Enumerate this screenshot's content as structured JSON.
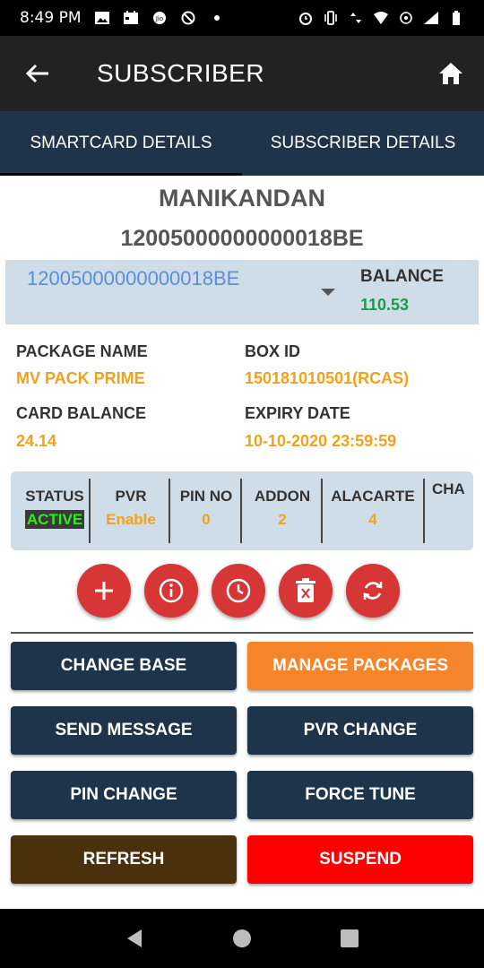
{
  "status_bar": {
    "time": "8:49 PM"
  },
  "app_bar": {
    "title": "SUBSCRIBER"
  },
  "tabs": [
    {
      "label": "SMARTCARD DETAILS",
      "active": true
    },
    {
      "label": "SUBSCRIBER DETAILS",
      "active": false
    }
  ],
  "subscriber": {
    "name": "MANIKANDAN",
    "card_number": "12005000000000018BE"
  },
  "card_select": {
    "selected": "12005000000000018BE",
    "balance_label": "BALANCE",
    "balance_value": "110.53"
  },
  "details": {
    "package_name_label": "PACKAGE NAME",
    "package_name_value": "MV PACK PRIME",
    "box_id_label": "BOX ID",
    "box_id_value": "150181010501(RCAS)",
    "card_balance_label": "CARD BALANCE",
    "card_balance_value": "24.14",
    "expiry_date_label": "EXPIRY DATE",
    "expiry_date_value": "10-10-2020 23:59:59"
  },
  "status_strip": {
    "status_label": "STATUS",
    "status_value": "ACTIVE",
    "pvr_label": "PVR",
    "pvr_value": "Enable",
    "pin_label": "PIN NO",
    "pin_value": "0",
    "addon_label": "ADDON",
    "addon_value": "2",
    "alacarte_label": "ALACARTE",
    "alacarte_value": "4",
    "cha_label": "CHA"
  },
  "action_icons": [
    "add-icon",
    "info-icon",
    "clock-icon",
    "delete-icon",
    "refresh-icon"
  ],
  "buttons": {
    "change_base": "CHANGE BASE",
    "manage_packages": "MANAGE PACKAGES",
    "send_message": "SEND MESSAGE",
    "pvr_change": "PVR CHANGE",
    "pin_change": "PIN CHANGE",
    "force_tune": "FORCE TUNE",
    "refresh": "REFRESH",
    "suspend": "SUSPEND"
  },
  "colors": {
    "navy": "#1e344a",
    "orange": "#f5842a",
    "brown": "#4b300e",
    "red": "#ff0000",
    "accent_value": "#f0a21a",
    "balance_green": "#1a9c4a",
    "active_green": "#2cf01b"
  }
}
